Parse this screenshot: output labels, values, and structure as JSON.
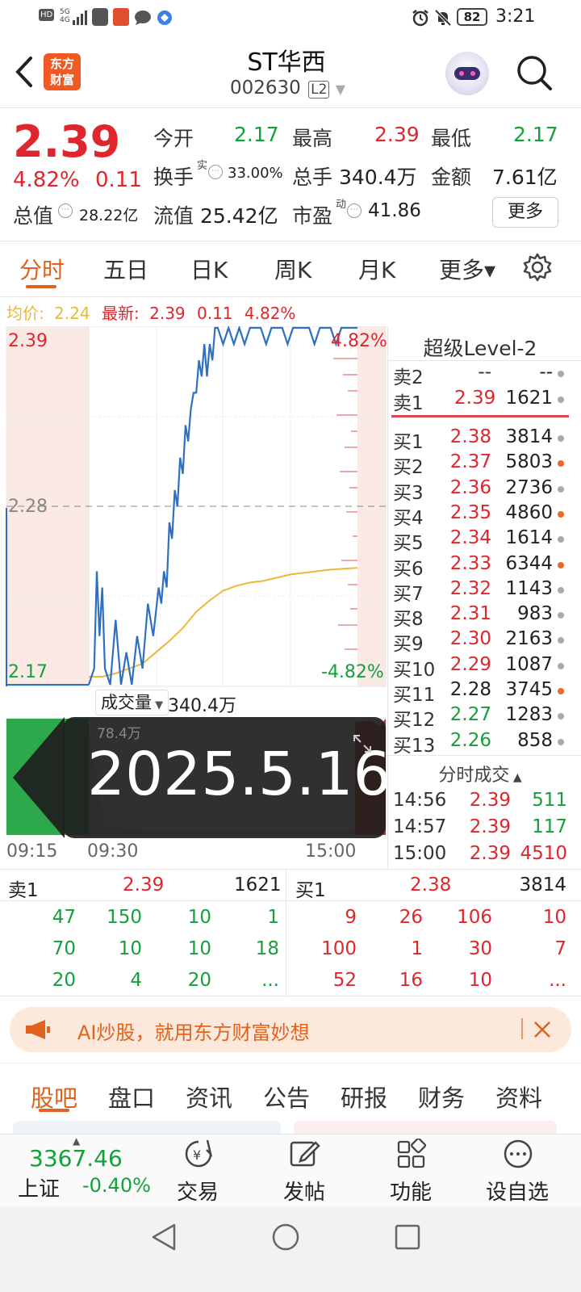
{
  "status": {
    "time": "3:21",
    "battery": "82",
    "left_icons": [
      "HD",
      "5G 4G",
      "signal",
      "sim",
      "app",
      "message",
      "browser"
    ]
  },
  "header": {
    "title": "ST华西",
    "code": "002630",
    "badge": "L2",
    "logo_line1": "东方",
    "logo_line2": "财富"
  },
  "quote": {
    "price": "2.39",
    "change_pct": "4.82%",
    "change": "0.11",
    "open_label": "今开",
    "open": "2.17",
    "high_label": "最高",
    "high": "2.39",
    "low_label": "最低",
    "low": "2.17",
    "turnover_label": "换手",
    "turnover_sup": "实",
    "turnover": "33.00%",
    "volume_label": "总手",
    "volume": "340.4万",
    "amount_label": "金额",
    "amount": "7.61亿",
    "mktcap_label": "总值",
    "mktcap": "28.22亿",
    "float_label": "流值",
    "float": "25.42亿",
    "pe_label": "市盈",
    "pe_sup": "动",
    "pe": "41.86",
    "more_button": "更多"
  },
  "tabs": [
    {
      "label": "分时",
      "active": true
    },
    {
      "label": "五日"
    },
    {
      "label": "日K"
    },
    {
      "label": "周K"
    },
    {
      "label": "月K"
    },
    {
      "label": "更多▾"
    }
  ],
  "chart_info": {
    "avg_label": "均价:",
    "avg_value": "2.24",
    "latest_label": "最新:",
    "latest_value": "2.39",
    "latest_change": "0.11",
    "latest_pct": "4.82%"
  },
  "chart_data": {
    "type": "line",
    "y_top_label": "2.39",
    "y_mid_label": "2.28",
    "y_bottom_label": "2.17",
    "pct_top": "4.82%",
    "pct_bottom": "-4.82%",
    "ylim": [
      2.17,
      2.39
    ],
    "x_ticks": [
      "09:15",
      "09:30",
      "15:00"
    ],
    "volume_label": "成交量",
    "volume_total": "340.4万",
    "volume_max": "78.4万",
    "date_overlay": "2025.5.16",
    "price_series": [
      [
        0.0,
        2.17
      ],
      [
        0.02,
        2.18
      ],
      [
        0.03,
        2.24
      ],
      [
        0.04,
        2.2
      ],
      [
        0.05,
        2.23
      ],
      [
        0.06,
        2.18
      ],
      [
        0.08,
        2.17
      ],
      [
        0.1,
        2.21
      ],
      [
        0.12,
        2.17
      ],
      [
        0.14,
        2.19
      ],
      [
        0.16,
        2.17
      ],
      [
        0.18,
        2.2
      ],
      [
        0.2,
        2.18
      ],
      [
        0.22,
        2.22
      ],
      [
        0.24,
        2.2
      ],
      [
        0.26,
        2.23
      ],
      [
        0.27,
        2.22
      ],
      [
        0.28,
        2.24
      ],
      [
        0.29,
        2.23
      ],
      [
        0.3,
        2.27
      ],
      [
        0.31,
        2.26
      ],
      [
        0.32,
        2.29
      ],
      [
        0.33,
        2.28
      ],
      [
        0.34,
        2.31
      ],
      [
        0.35,
        2.3
      ],
      [
        0.36,
        2.33
      ],
      [
        0.37,
        2.32
      ],
      [
        0.38,
        2.34
      ],
      [
        0.39,
        2.35
      ],
      [
        0.4,
        2.35
      ],
      [
        0.41,
        2.37
      ],
      [
        0.42,
        2.36
      ],
      [
        0.43,
        2.38
      ],
      [
        0.44,
        2.36
      ],
      [
        0.45,
        2.38
      ],
      [
        0.46,
        2.37
      ],
      [
        0.47,
        2.39
      ],
      [
        0.48,
        2.39
      ],
      [
        0.5,
        2.38
      ],
      [
        0.52,
        2.39
      ],
      [
        0.54,
        2.38
      ],
      [
        0.56,
        2.39
      ],
      [
        0.58,
        2.38
      ],
      [
        0.6,
        2.39
      ],
      [
        0.64,
        2.39
      ],
      [
        0.66,
        2.38
      ],
      [
        0.68,
        2.39
      ],
      [
        0.72,
        2.39
      ],
      [
        0.74,
        2.38
      ],
      [
        0.76,
        2.39
      ],
      [
        0.82,
        2.39
      ],
      [
        0.84,
        2.38
      ],
      [
        0.86,
        2.39
      ],
      [
        0.9,
        2.39
      ],
      [
        0.92,
        2.38
      ],
      [
        0.94,
        2.39
      ],
      [
        1.0,
        2.39
      ]
    ],
    "avg_series": [
      [
        0.0,
        2.175
      ],
      [
        0.05,
        2.175
      ],
      [
        0.1,
        2.177
      ],
      [
        0.15,
        2.18
      ],
      [
        0.2,
        2.183
      ],
      [
        0.25,
        2.19
      ],
      [
        0.3,
        2.197
      ],
      [
        0.35,
        2.205
      ],
      [
        0.4,
        2.215
      ],
      [
        0.45,
        2.222
      ],
      [
        0.5,
        2.228
      ],
      [
        0.55,
        2.231
      ],
      [
        0.6,
        2.233
      ],
      [
        0.65,
        2.234
      ],
      [
        0.7,
        2.236
      ],
      [
        0.75,
        2.238
      ],
      [
        0.8,
        2.239
      ],
      [
        0.85,
        2.24
      ],
      [
        0.9,
        2.241
      ],
      [
        1.0,
        2.242
      ]
    ]
  },
  "orderbook": {
    "title": "超级Level-2",
    "sells": [
      {
        "label": "卖2",
        "price": "--",
        "qty": "--"
      },
      {
        "label": "卖1",
        "price": "2.39",
        "qty": "1621"
      }
    ],
    "buys": [
      {
        "label": "买1",
        "price": "2.38",
        "qty": "3814",
        "price_color": "red",
        "dot": "gray"
      },
      {
        "label": "买2",
        "price": "2.37",
        "qty": "5803",
        "price_color": "red",
        "dot": "orange"
      },
      {
        "label": "买3",
        "price": "2.36",
        "qty": "2736",
        "price_color": "red",
        "dot": "gray"
      },
      {
        "label": "买4",
        "price": "2.35",
        "qty": "4860",
        "price_color": "red",
        "dot": "orange"
      },
      {
        "label": "买5",
        "price": "2.34",
        "qty": "1614",
        "price_color": "red",
        "dot": "gray"
      },
      {
        "label": "买6",
        "price": "2.33",
        "qty": "6344",
        "price_color": "red",
        "dot": "orange"
      },
      {
        "label": "买7",
        "price": "2.32",
        "qty": "1143",
        "price_color": "red",
        "dot": "gray"
      },
      {
        "label": "买8",
        "price": "2.31",
        "qty": "983",
        "price_color": "red",
        "dot": "gray"
      },
      {
        "label": "买9",
        "price": "2.30",
        "qty": "2163",
        "price_color": "red",
        "dot": "gray"
      },
      {
        "label": "买10",
        "price": "2.29",
        "qty": "1087",
        "price_color": "red",
        "dot": "gray"
      },
      {
        "label": "买11",
        "price": "2.28",
        "qty": "3745",
        "price_color": "black",
        "dot": "orange"
      },
      {
        "label": "买12",
        "price": "2.27",
        "qty": "1283",
        "price_color": "green",
        "dot": "gray"
      },
      {
        "label": "买13",
        "price": "2.26",
        "qty": "858",
        "price_color": "green",
        "dot": "gray"
      }
    ],
    "ticks_title": "分时成交",
    "ticks": [
      {
        "time": "14:56",
        "price": "2.39",
        "qty": "511"
      },
      {
        "time": "14:57",
        "price": "2.39",
        "qty": "117"
      },
      {
        "time": "15:00",
        "price": "2.39",
        "qty": "4510"
      }
    ]
  },
  "depth": {
    "sell_label": "卖1",
    "sell_price": "2.39",
    "sell_qty": "1621",
    "buy_label": "买1",
    "buy_price": "2.38",
    "buy_qty": "3814",
    "sell_rows": [
      [
        "47",
        "150",
        "10",
        "1"
      ],
      [
        "70",
        "10",
        "10",
        "18"
      ],
      [
        "20",
        "4",
        "20",
        "..."
      ]
    ],
    "buy_rows": [
      [
        "9",
        "26",
        "106",
        "10"
      ],
      [
        "100",
        "1",
        "30",
        "7"
      ],
      [
        "52",
        "16",
        "10",
        "..."
      ]
    ]
  },
  "ad": {
    "text": "AI炒股，就用东方财富妙想"
  },
  "bottom_tabs": [
    "股吧",
    "盘口",
    "资讯",
    "公告",
    "研报",
    "财务",
    "资料"
  ],
  "nav": {
    "index_value": "3367.46",
    "index_name": "上证",
    "index_change": "-0.40%",
    "items": [
      "交易",
      "发帖",
      "功能",
      "设自选"
    ]
  },
  "colors": {
    "red": "#e0262d",
    "green": "#14a03c",
    "blue": "#2f6fc2",
    "avg": "#e8b93a",
    "accent": "#e0621c"
  }
}
